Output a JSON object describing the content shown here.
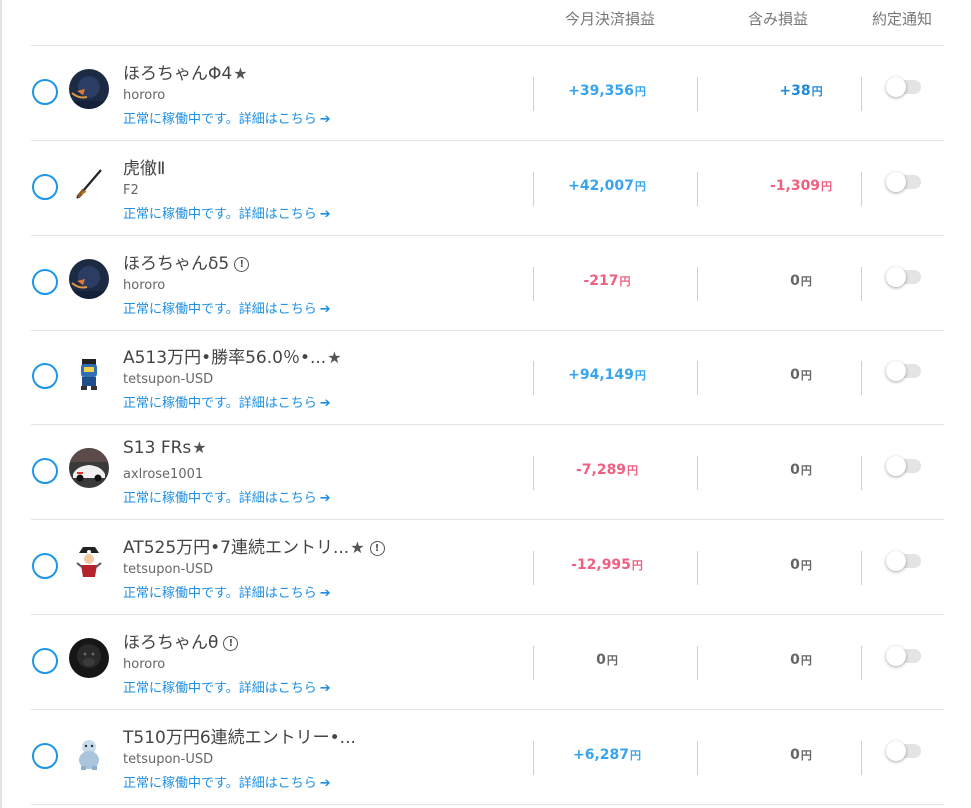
{
  "header": {
    "monthly_pnl": "今月決済損益",
    "unrealized_pnl": "含み損益",
    "fill_notify": "約定通知"
  },
  "currency_unit": "円",
  "status_arrow": "➔",
  "rows": [
    {
      "name": "ほろちゃんΦ4",
      "star": "★",
      "info": "",
      "sub": "hororo",
      "status": "正常に稼働中です。詳細はこちら",
      "monthly": "+39,356",
      "monthly_sign": "pos",
      "unrealized": "+38",
      "unrealized_sign": "pos-dark",
      "avatar": "dark-figure-avatar",
      "notify_on": false
    },
    {
      "name": "虎徹Ⅱ",
      "star": "",
      "info": "",
      "sub": "F2",
      "status": "正常に稼働中です。詳細はこちら",
      "monthly": "+42,007",
      "monthly_sign": "pos",
      "unrealized": "-1,309",
      "unrealized_sign": "neg",
      "avatar": "katana-avatar",
      "notify_on": false
    },
    {
      "name": "ほろちゃんδ5",
      "star": "",
      "info": "!",
      "sub": "hororo",
      "status": "正常に稼働中です。詳細はこちら",
      "monthly": "-217",
      "monthly_sign": "neg",
      "unrealized": "0",
      "unrealized_sign": "zero",
      "avatar": "dark-figure-avatar",
      "notify_on": false
    },
    {
      "name": "A513万円•勝率56.0％•...",
      "star": "★",
      "info": "",
      "sub": "tetsupon-USD",
      "status": "正常に稼働中です。詳細はこちら",
      "monthly": "+94,149",
      "monthly_sign": "pos",
      "unrealized": "0",
      "unrealized_sign": "zero",
      "avatar": "robot-character-avatar",
      "notify_on": false
    },
    {
      "name": "S13 FRs",
      "star": "★",
      "info": "",
      "sub": "axlrose1001",
      "status": "正常に稼働中です。詳細はこちら",
      "monthly": "-7,289",
      "monthly_sign": "neg",
      "unrealized": "0",
      "unrealized_sign": "zero",
      "avatar": "car-avatar",
      "notify_on": false
    },
    {
      "name": "AT525万円•7連続エントリ...",
      "star": "★",
      "info": "!",
      "sub": "tetsupon-USD",
      "status": "正常に稼働中です。詳細はこちら",
      "monthly": "-12,995",
      "monthly_sign": "neg",
      "unrealized": "0",
      "unrealized_sign": "zero",
      "avatar": "pirate-character-avatar",
      "notify_on": false
    },
    {
      "name": "ほろちゃんθ",
      "star": "",
      "info": "!",
      "sub": "hororo",
      "status": "正常に稼働中です。詳細はこちら",
      "monthly": "0",
      "monthly_sign": "zero",
      "unrealized": "0",
      "unrealized_sign": "zero",
      "avatar": "dark-gorilla-avatar",
      "notify_on": false
    },
    {
      "name": "T510万円6連続エントリー•...",
      "star": "",
      "info": "",
      "sub": "tetsupon-USD",
      "status": "正常に稼働中です。詳細はこちら",
      "monthly": "+6,287",
      "monthly_sign": "pos",
      "unrealized": "0",
      "unrealized_sign": "zero",
      "avatar": "yeti-character-avatar",
      "notify_on": false
    }
  ]
}
